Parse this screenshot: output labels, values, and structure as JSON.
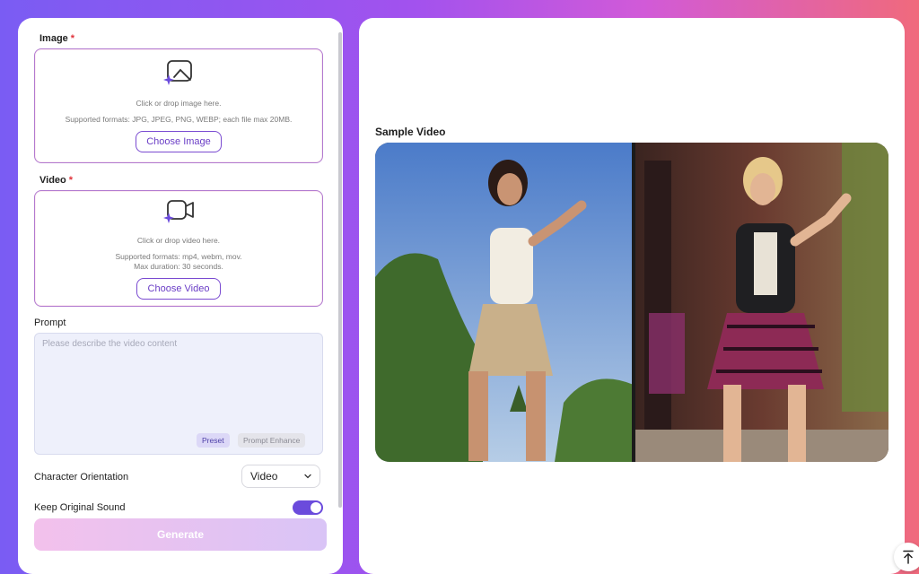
{
  "form": {
    "image": {
      "label": "Image",
      "required_mark": "*",
      "hint": "Click or drop image here.",
      "formats": "Supported formats: JPG, JPEG, PNG, WEBP; each file max 20MB.",
      "button": "Choose Image"
    },
    "video": {
      "label": "Video",
      "required_mark": "*",
      "hint": "Click or drop video here.",
      "formats": "Supported formats: mp4, webm, mov.",
      "duration": "Max duration: 30 seconds.",
      "button": "Choose Video"
    },
    "prompt": {
      "label": "Prompt",
      "placeholder": "Please describe the video content",
      "preset": "Preset",
      "enhance": "Prompt Enhance"
    },
    "orientation": {
      "label": "Character Orientation",
      "value": "Video"
    },
    "sound": {
      "label": "Keep Original Sound",
      "enabled": true
    },
    "generate": "Generate"
  },
  "preview": {
    "title": "Sample Video"
  },
  "colors": {
    "accent": "#6b4bdc",
    "dropzone_border": "#b17ad0",
    "required": "#e0323a"
  }
}
